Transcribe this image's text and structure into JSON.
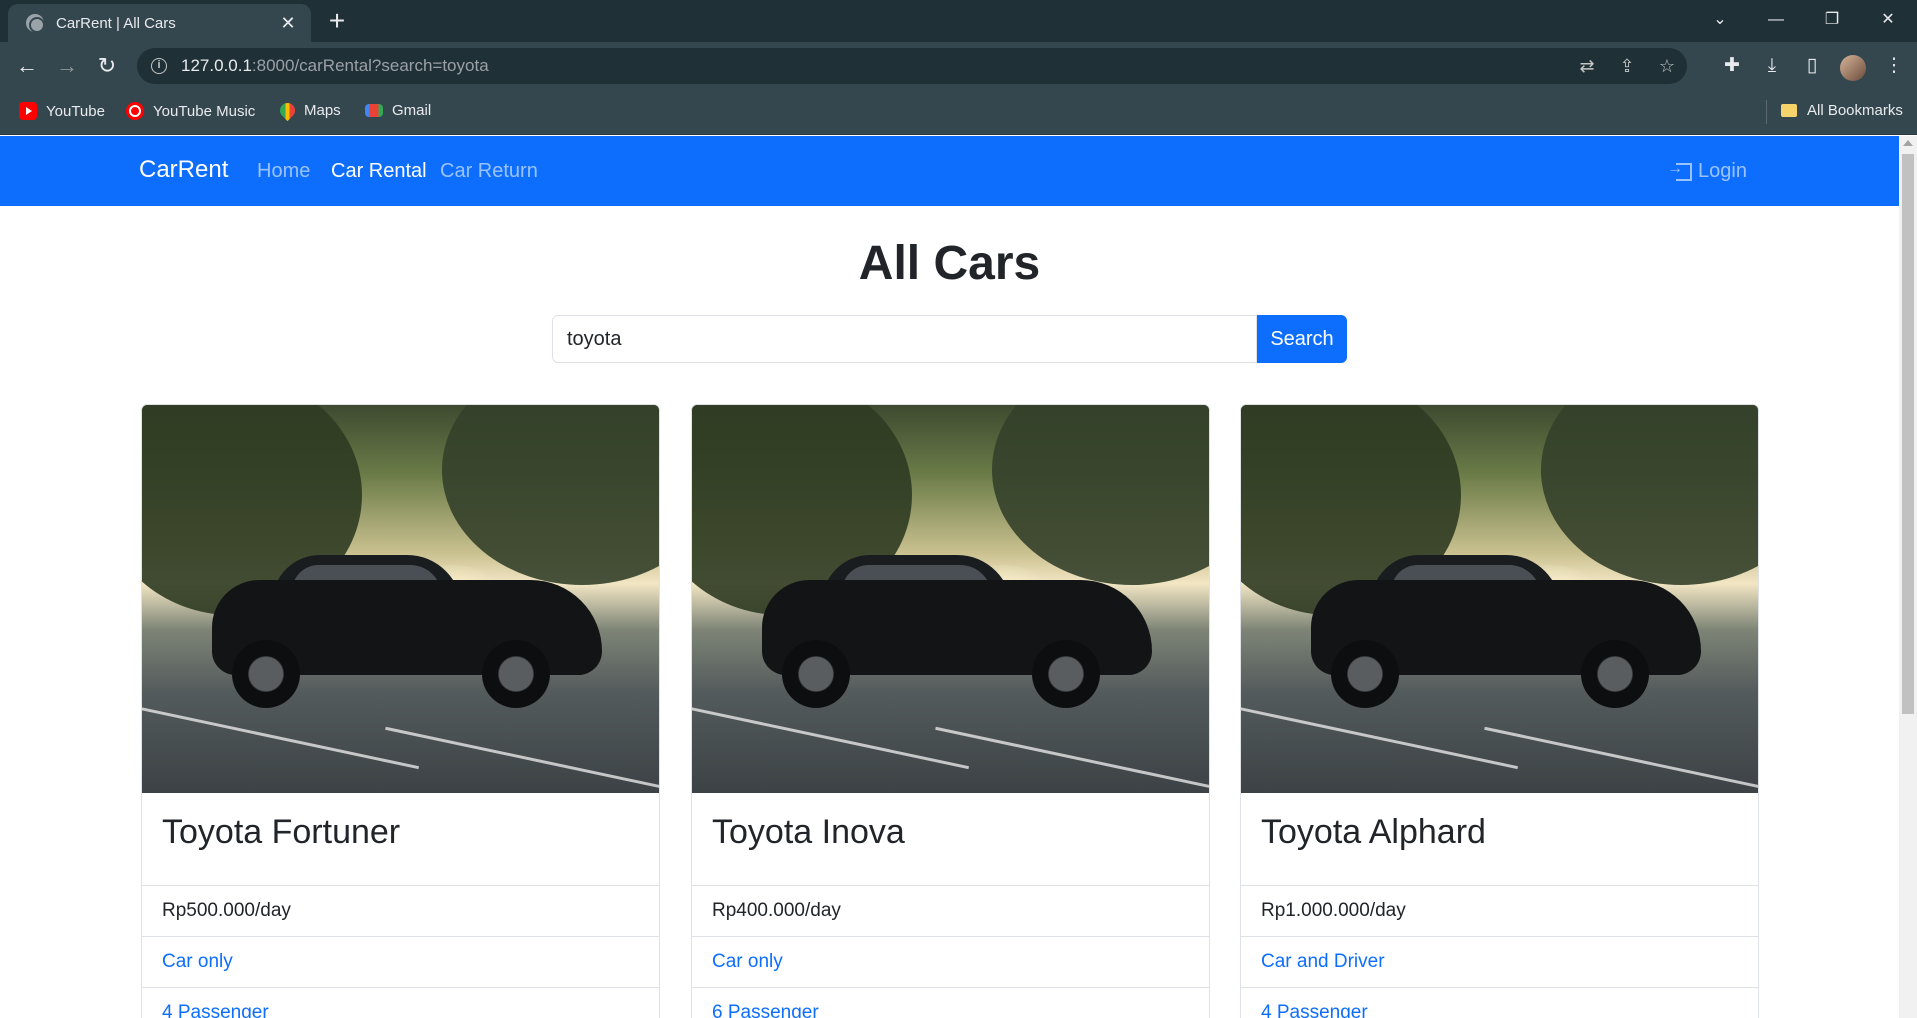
{
  "browser": {
    "tab_title": "CarRent | All Cars",
    "tab_close": "✕",
    "new_tab": "+",
    "url_host": "127.0.0.1",
    "url_path": ":8000/carRental?search=toyota",
    "bookmarks": [
      {
        "label": "YouTube",
        "icon": "youtube-icon"
      },
      {
        "label": "YouTube Music",
        "icon": "youtube-music-icon"
      },
      {
        "label": "Maps",
        "icon": "maps-icon"
      },
      {
        "label": "Gmail",
        "icon": "gmail-icon"
      }
    ],
    "all_bookmarks": "All Bookmarks"
  },
  "navbar": {
    "brand": "CarRent",
    "links": [
      "Home",
      "Car Rental",
      "Car Return"
    ],
    "active_link": "Car Rental",
    "login": "Login",
    "color": "#0d6efd"
  },
  "main": {
    "title": "All Cars",
    "search": {
      "value": "toyota",
      "button": "Search"
    }
  },
  "cars": [
    {
      "name": "Toyota Fortuner",
      "price": "Rp500.000/day",
      "service": "Car only",
      "capacity": "4 Passenger"
    },
    {
      "name": "Toyota Inova",
      "price": "Rp400.000/day",
      "service": "Car only",
      "capacity": "6 Passenger"
    },
    {
      "name": "Toyota Alphard",
      "price": "Rp1.000.000/day",
      "service": "Car and Driver",
      "capacity": "4 Passenger"
    }
  ]
}
